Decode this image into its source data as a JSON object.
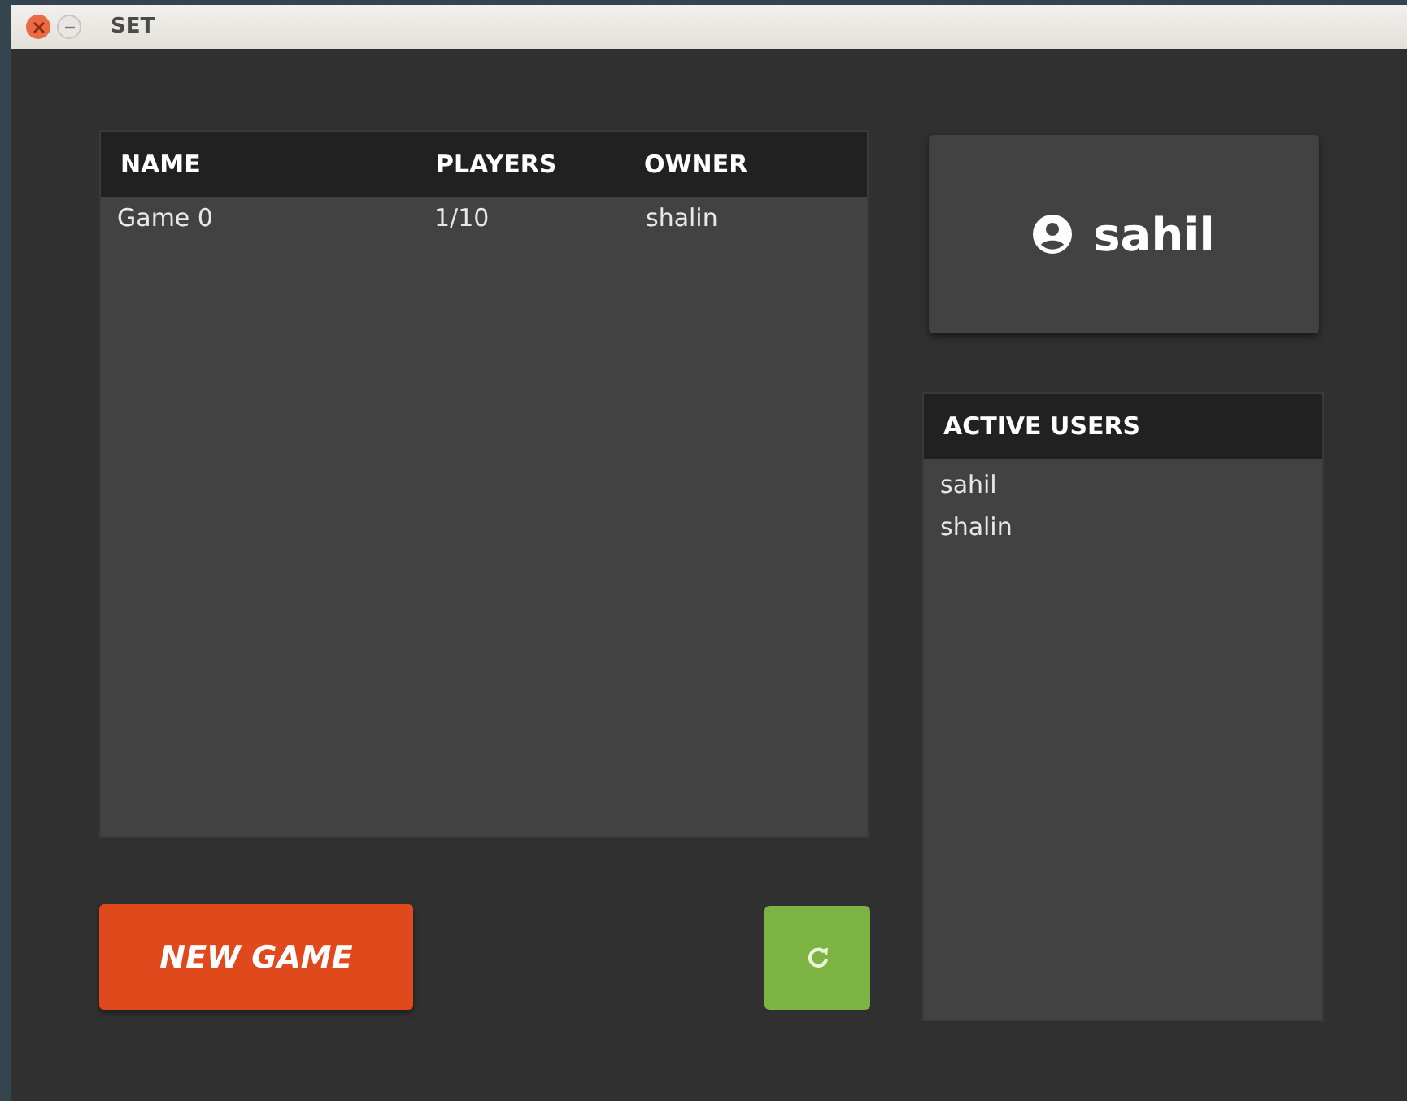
{
  "window": {
    "title": "SET"
  },
  "games_table": {
    "columns": [
      "NAME",
      "PLAYERS",
      "OWNER"
    ],
    "rows": [
      [
        "Game 0",
        "1/10",
        "shalin"
      ]
    ]
  },
  "user_card": {
    "username": "sahil"
  },
  "active_users": {
    "title": "ACTIVE USERS",
    "users": [
      "sahil",
      "shalin"
    ]
  },
  "new_game_button": {
    "label": "NEW GAME"
  }
}
